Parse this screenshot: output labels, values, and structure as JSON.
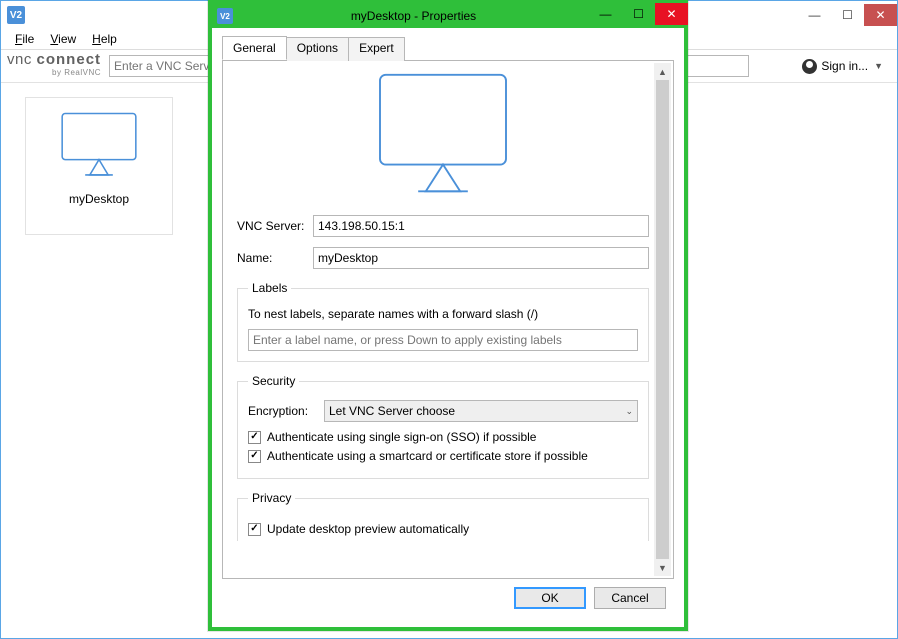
{
  "mainWindow": {
    "menus": {
      "file": "File",
      "view": "View",
      "help": "Help"
    },
    "brand1": "vnc ",
    "brand2": "connect",
    "brandSub": "by RealVNC",
    "searchPlaceholder": "Enter a VNC Server address or search",
    "signin": "Sign in...",
    "connection": {
      "label": "myDesktop"
    },
    "winCtrls": {
      "min": "—",
      "max": "☐",
      "close": "✕"
    }
  },
  "dialog": {
    "title": "myDesktop - Properties",
    "tabs": {
      "general": "General",
      "options": "Options",
      "expert": "Expert"
    },
    "vncServerLabel": "VNC Server:",
    "vncServerValue": "143.198.50.15:1",
    "nameLabel": "Name:",
    "nameValue": "myDesktop",
    "labelsLegend": "Labels",
    "labelsHint": "To nest labels, separate names with a forward slash (/)",
    "labelsPlaceholder": "Enter a label name, or press Down to apply existing labels",
    "securityLegend": "Security",
    "encryptionLabel": "Encryption:",
    "encryptionValue": "Let VNC Server choose",
    "ssoLabel": "Authenticate using single sign-on (SSO) if possible",
    "smartcardLabel": "Authenticate using a smartcard or certificate store if possible",
    "privacyLegend": "Privacy",
    "previewLabel": "Update desktop preview automatically",
    "ok": "OK",
    "cancel": "Cancel",
    "winCtrls": {
      "min": "—",
      "max": "☐",
      "close": "✕"
    }
  },
  "checks": {
    "sso": "✓",
    "smartcard": "✓",
    "preview": "✓"
  }
}
